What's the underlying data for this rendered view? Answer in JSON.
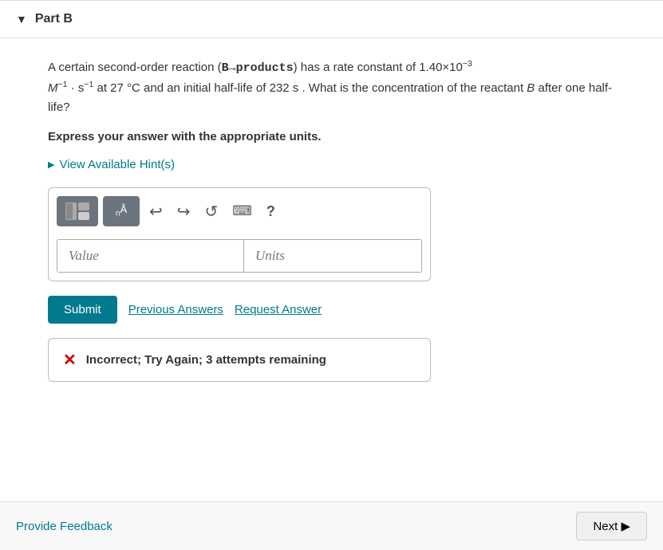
{
  "part": {
    "label": "Part B",
    "arrow": "▼"
  },
  "question": {
    "text_parts": [
      "A certain second-order reaction (",
      "B→products",
      ") has a rate constant of 1.40×10",
      "−3",
      " ",
      "M",
      "−1",
      " · s",
      "−1",
      " at 27 °C and an initial half-life of 232 s . What is the concentration of the reactant B after one half-life?"
    ],
    "express_label": "Express your answer with the appropriate units.",
    "hint_label": "View Available Hint(s)"
  },
  "toolbar": {
    "btn1_icon": "⊞",
    "btn2_label": "ₙÅ",
    "undo_icon": "↩",
    "redo_icon": "↪",
    "refresh_icon": "↺",
    "keyboard_icon": "⌨",
    "help_icon": "?"
  },
  "inputs": {
    "value_placeholder": "Value",
    "units_placeholder": "Units"
  },
  "actions": {
    "submit_label": "Submit",
    "previous_answers_label": "Previous Answers",
    "request_answer_label": "Request Answer"
  },
  "feedback": {
    "icon": "✕",
    "message": "Incorrect; Try Again; 3 attempts remaining"
  },
  "bottom": {
    "feedback_label": "Provide Feedback",
    "next_label": "Next ▶"
  }
}
